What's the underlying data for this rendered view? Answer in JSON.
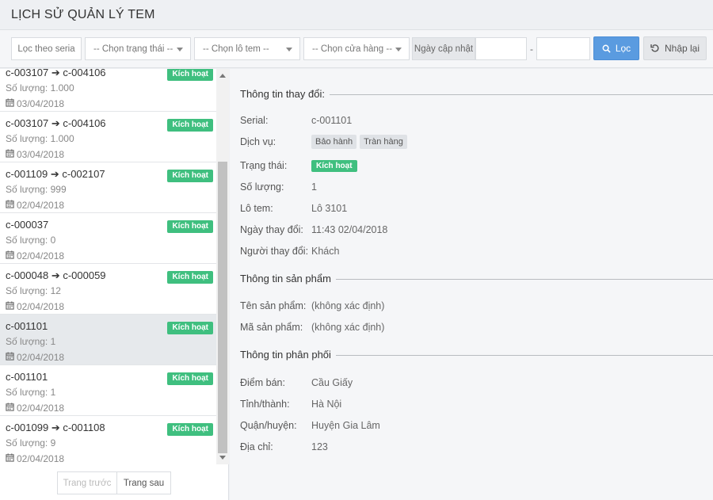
{
  "header": {
    "title": "LỊCH SỬ QUẢN LÝ TEM"
  },
  "filters": {
    "serial_placeholder": "Lọc theo seria",
    "status_select": "-- Chọn trạng thái --",
    "batch_select": "-- Chọn lô tem --",
    "store_select": "-- Chọn cửa hàng --",
    "date_label": "Ngày cập nhật",
    "date_separator": "-",
    "filter_button": "Lọc",
    "reset_button": "Nhập lại"
  },
  "list": {
    "qty_prefix": "Số lượng: ",
    "items": [
      {
        "serial": "c-003107 ➔ c-004106",
        "badge": "Kích hoạt",
        "qty": "Số lượng: 1.000",
        "date": "03/04/2018",
        "active": false
      },
      {
        "serial": "c-003107 ➔ c-004106",
        "badge": "Kích hoạt",
        "qty": "Số lượng: 1.000",
        "date": "03/04/2018",
        "active": false
      },
      {
        "serial": "c-001109 ➔ c-002107",
        "badge": "Kích hoạt",
        "qty": "Số lượng: 999",
        "date": "02/04/2018",
        "active": false
      },
      {
        "serial": "c-000037",
        "badge": "Kích hoạt",
        "qty": "Số lượng: 0",
        "date": "02/04/2018",
        "active": false
      },
      {
        "serial": "c-000048 ➔ c-000059",
        "badge": "Kích hoạt",
        "qty": "Số lượng: 12",
        "date": "02/04/2018",
        "active": false
      },
      {
        "serial": "c-001101",
        "badge": "Kích hoạt",
        "qty": "Số lượng: 1",
        "date": "02/04/2018",
        "active": true
      },
      {
        "serial": "c-001101",
        "badge": "Kích hoạt",
        "qty": "Số lượng: 1",
        "date": "02/04/2018",
        "active": false
      },
      {
        "serial": "c-001099 ➔ c-001108",
        "badge": "Kích hoạt",
        "qty": "Số lượng: 9",
        "date": "02/04/2018",
        "active": false
      }
    ]
  },
  "pager": {
    "prev": "Trang trước",
    "next": "Trang sau"
  },
  "detail": {
    "change_title": "Thông tin thay đổi:",
    "serial_label": "Serial:",
    "serial_value": "c-001101",
    "service_label": "Dịch vụ:",
    "service_tags": [
      "Bảo hành",
      "Tràn hàng"
    ],
    "status_label": "Trạng thái:",
    "status_value": "Kích hoạt",
    "qty_label": "Số lượng:",
    "qty_value": "1",
    "batch_label": "Lô tem:",
    "batch_value": "Lô 3101",
    "date_label": "Ngày thay đổi:",
    "date_value": "11:43 02/04/2018",
    "user_label": "Người thay đổi:",
    "user_value": "Khách",
    "product_title": "Thông tin sản phẩm",
    "pname_label": "Tên sản phẩm:",
    "pname_value": "(không xác định)",
    "pcode_label": "Mã sản phẩm:",
    "pcode_value": "(không xác định)",
    "dist_title": "Thông tin phân phối",
    "point_label": "Điểm bán:",
    "point_value": "Cầu Giấy",
    "province_label": "Tỉnh/thành:",
    "province_value": "Hà Nội",
    "district_label": "Quận/huyện:",
    "district_value": "Huyện Gia Lâm",
    "address_label": "Địa chỉ:",
    "address_value": "123"
  },
  "colors": {
    "accent": "#5a9be0",
    "badge": "#3fbf7f",
    "active_row": "#e6e9ec"
  }
}
